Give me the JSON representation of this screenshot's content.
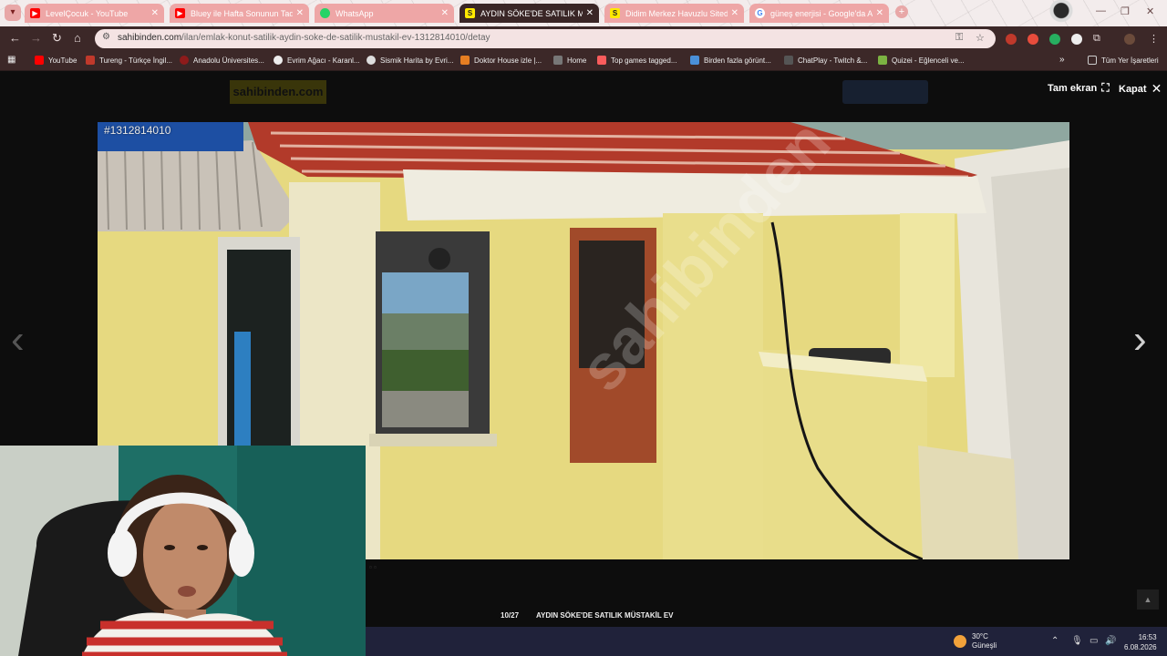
{
  "browser": {
    "tabs": [
      {
        "label": "LevelÇocuk - YouTube",
        "icon": "youtube-icon",
        "color": "#ff0000"
      },
      {
        "label": "Bluey ile Hafta Sonunun Tadını",
        "icon": "youtube-icon",
        "color": "#ff0000"
      },
      {
        "label": "WhatsApp",
        "icon": "whatsapp-icon",
        "color": "#25d366"
      },
      {
        "label": "AYDIN SÖKE'DE SATILIK MÜSTAKİL",
        "icon": "sahibinden-icon",
        "color": "#ffe800"
      },
      {
        "label": "Didim Merkez Havuzlu Sitede",
        "icon": "sahibinden-icon",
        "color": "#ffe800"
      },
      {
        "label": "güneş enerjisi - Google'da Ara",
        "icon": "google-icon",
        "color": "#4285f4"
      }
    ],
    "url_host": "sahibinden.com",
    "url_path": "/ilan/emlak-konut-satilik-aydin-soke-de-satilik-mustakil-ev-1312814010/detay",
    "bookmarks": [
      {
        "label": "YouTube",
        "color": "#ff0000"
      },
      {
        "label": "Tureng - Türkçe İngil...",
        "color": "#c0392b"
      },
      {
        "label": "Anadolu Üniversites...",
        "color": "#8e1b1b"
      },
      {
        "label": "Evrim Ağacı - Karanl...",
        "color": "#eeeeee"
      },
      {
        "label": "Sismik Harita by Evri...",
        "color": "#dddddd"
      },
      {
        "label": "Doktor House izle |...",
        "color": "#e67e22"
      },
      {
        "label": "Home",
        "color": "#333333"
      },
      {
        "label": "Top games tagged...",
        "color": "#fa5c5c"
      },
      {
        "label": "Birden fazla görünt...",
        "color": "#4a90d9"
      },
      {
        "label": "ChatPlay - Twitch &...",
        "color": "#222222"
      },
      {
        "label": "Quizei - Eğlenceli ve...",
        "color": "#7cb342"
      }
    ],
    "all_bookmarks": "Tüm Yer İşaretleri"
  },
  "page": {
    "logo": "sahibinden.com",
    "fullscreen_label": "Tam ekran",
    "close_label": "Kapat",
    "listing_id": "#1312814010",
    "counter": "10/27",
    "caption": "AYDIN SÖKE'DE SATILIK MÜSTAKİL EV"
  },
  "taskbar": {
    "temp": "30°C",
    "condition": "Güneşli",
    "time": "16:53",
    "date": "6.08.2026"
  }
}
